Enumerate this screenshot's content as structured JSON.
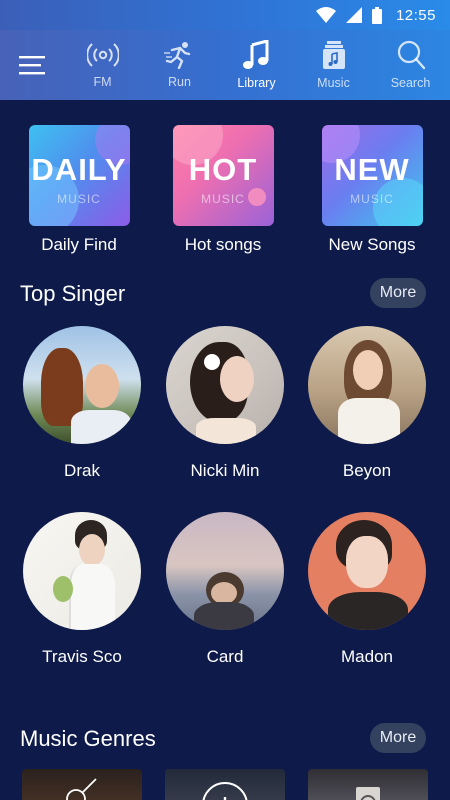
{
  "status": {
    "time": "12:55"
  },
  "nav": {
    "items": [
      {
        "label": "FM",
        "icon": "radio-icon"
      },
      {
        "label": "Run",
        "icon": "runner-icon"
      },
      {
        "label": "Library",
        "icon": "music-note-icon"
      },
      {
        "label": "Music",
        "icon": "music-stack-icon"
      },
      {
        "label": "Search",
        "icon": "search-icon"
      }
    ],
    "active": "Library"
  },
  "featured": [
    {
      "tile_big": "DAILY",
      "tile_small": "MUSIC",
      "caption": "Daily Find"
    },
    {
      "tile_big": "HOT",
      "tile_small": "MUSIC",
      "caption": "Hot songs"
    },
    {
      "tile_big": "NEW",
      "tile_small": "MUSIC",
      "caption": "New Songs"
    }
  ],
  "top_singer": {
    "title": "Top Singer",
    "more_label": "More",
    "singers": [
      {
        "name": "Drak"
      },
      {
        "name": "Nicki Min"
      },
      {
        "name": "Beyon"
      },
      {
        "name": "Travis Sco"
      },
      {
        "name": "Card"
      },
      {
        "name": "Madon"
      }
    ]
  },
  "music_genres": {
    "title": "Music Genres",
    "more_label": "More"
  },
  "colors": {
    "background": "#0e1b4a",
    "header_start": "#4762b8",
    "header_end": "#2d86e2",
    "more_button": "#34415f"
  }
}
